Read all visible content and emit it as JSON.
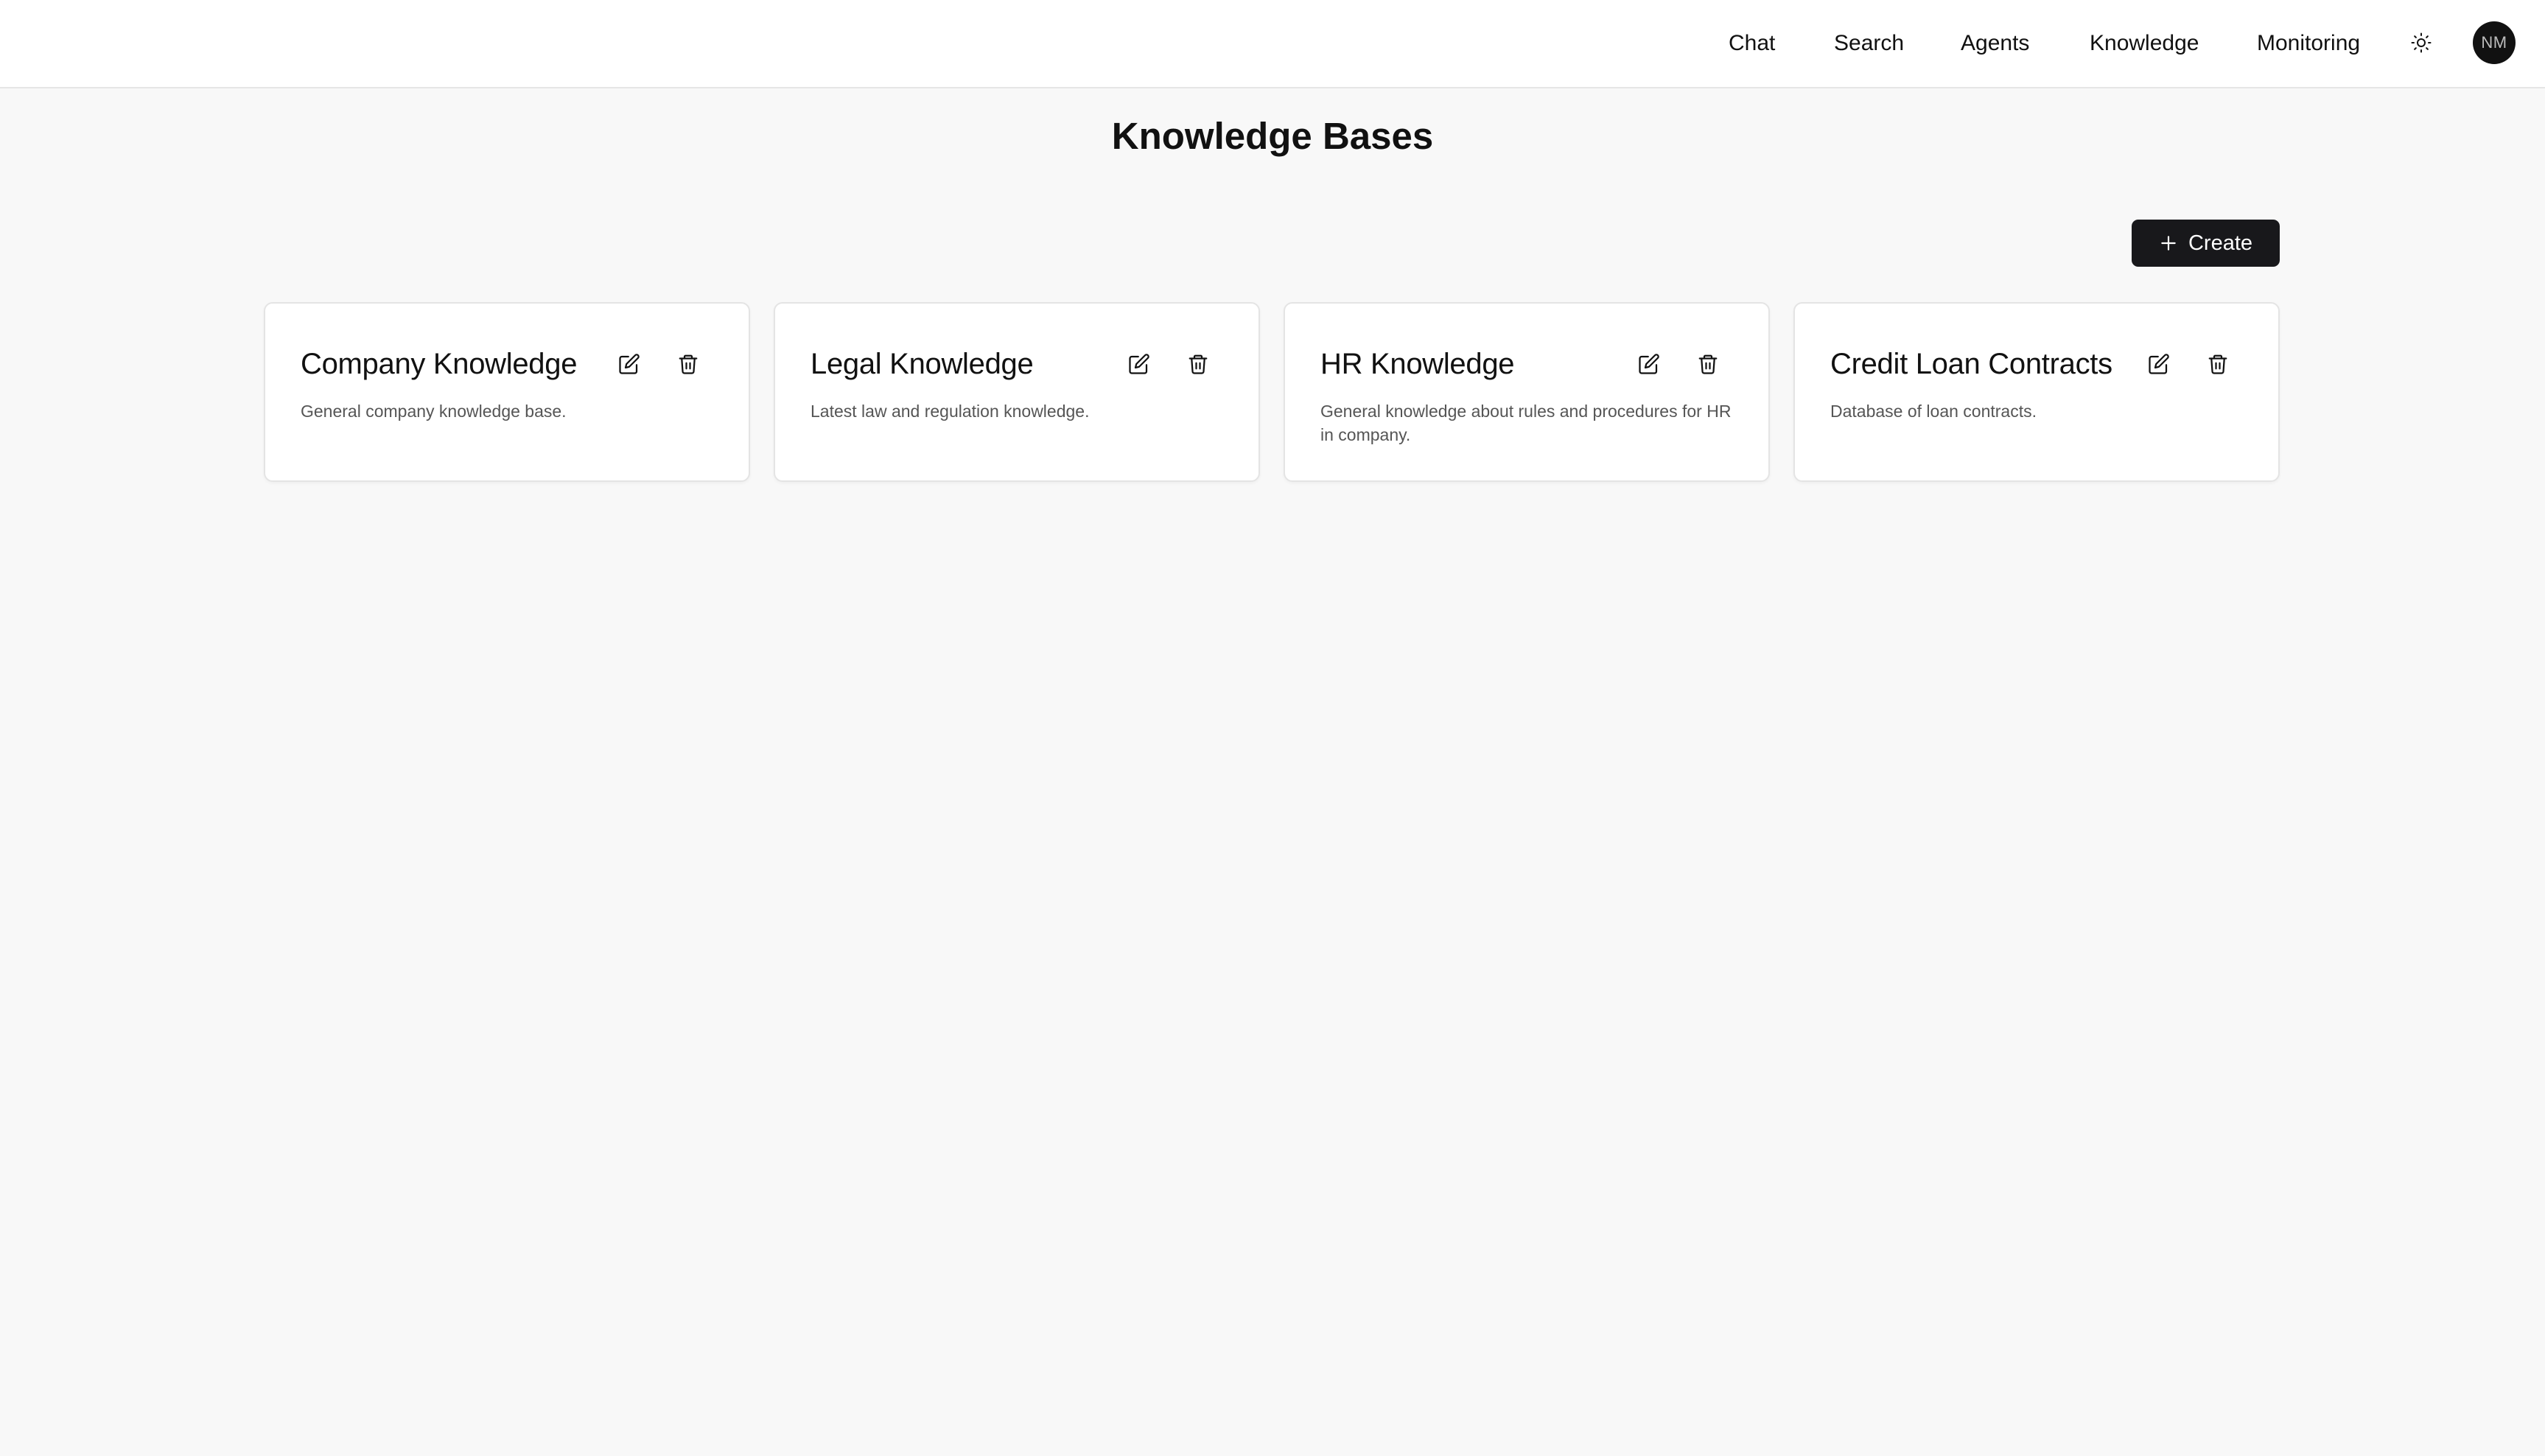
{
  "nav": {
    "items": [
      {
        "label": "Chat"
      },
      {
        "label": "Search"
      },
      {
        "label": "Agents"
      },
      {
        "label": "Knowledge"
      },
      {
        "label": "Monitoring"
      }
    ],
    "theme_icon": "sun-icon",
    "avatar_initials": "NM"
  },
  "page": {
    "title": "Knowledge Bases"
  },
  "toolbar": {
    "create_label": "Create",
    "create_icon": "plus-icon"
  },
  "cards": [
    {
      "title": "Company Knowledge",
      "description": "General company knowledge base.",
      "edit_icon": "edit-icon",
      "delete_icon": "trash-icon"
    },
    {
      "title": "Legal Knowledge",
      "description": "Latest law and regulation knowledge.",
      "edit_icon": "edit-icon",
      "delete_icon": "trash-icon"
    },
    {
      "title": "HR Knowledge",
      "description": "General knowledge about rules and procedures for HR in company.",
      "edit_icon": "edit-icon",
      "delete_icon": "trash-icon"
    },
    {
      "title": "Credit Loan Contracts",
      "description": "Database of loan contracts.",
      "edit_icon": "edit-icon",
      "delete_icon": "trash-icon"
    }
  ],
  "colors": {
    "background": "#f8f8f8",
    "surface": "#ffffff",
    "primary_button": "#18181b",
    "avatar_bg": "#111111",
    "muted_text": "#555555"
  }
}
